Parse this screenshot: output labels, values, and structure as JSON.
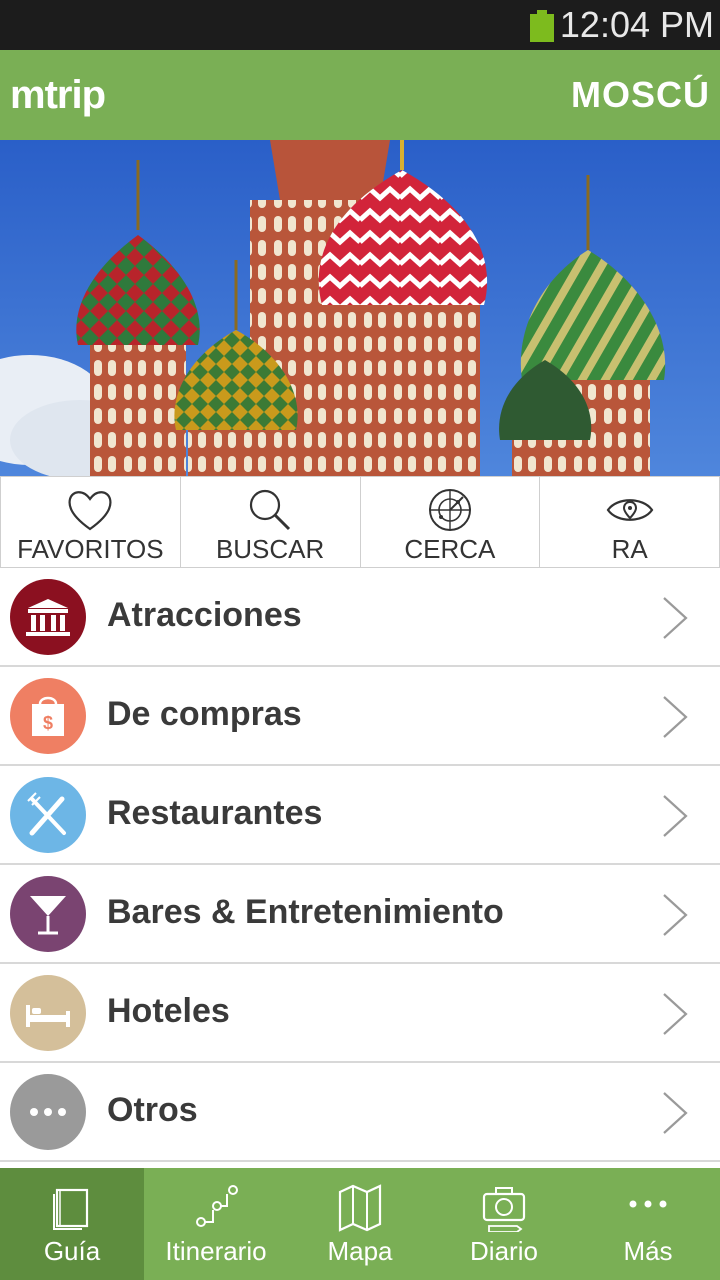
{
  "status_bar": {
    "time": "12:04 PM",
    "battery_icon": "battery-full-icon",
    "battery_color": "#7dbb1e"
  },
  "app_bar": {
    "logo": "mtrip",
    "city": "MOSCÚ",
    "color": "#7aaf55"
  },
  "hero": {
    "image": "st-basils-cathedral-photo"
  },
  "quick_actions": [
    {
      "label": "FAVORITOS",
      "icon": "heart-icon"
    },
    {
      "label": "BUSCAR",
      "icon": "search-icon"
    },
    {
      "label": "CERCA",
      "icon": "radar-icon"
    },
    {
      "label": "RA",
      "icon": "eye-icon"
    }
  ],
  "categories": [
    {
      "label": "Atracciones",
      "icon": "museum-icon",
      "color": "#8b1020"
    },
    {
      "label": "De compras",
      "icon": "shopping-bag-icon",
      "color": "#ef7f63"
    },
    {
      "label": "Restaurantes",
      "icon": "fork-knife-icon",
      "color": "#6db6e6"
    },
    {
      "label": "Bares & Entretenimiento",
      "icon": "cocktail-icon",
      "color": "#7a4471"
    },
    {
      "label": "Hoteles",
      "icon": "bed-icon",
      "color": "#d4bf9a"
    },
    {
      "label": "Otros",
      "icon": "more-dots-icon",
      "color": "#9a9a9a"
    }
  ],
  "tab_bar": {
    "active": "Guía",
    "items": [
      {
        "label": "Guía",
        "icon": "guide-book-icon"
      },
      {
        "label": "Itinerario",
        "icon": "route-icon"
      },
      {
        "label": "Mapa",
        "icon": "map-icon"
      },
      {
        "label": "Diario",
        "icon": "camera-icon"
      },
      {
        "label": "Más",
        "icon": "more-dots-icon"
      }
    ]
  }
}
